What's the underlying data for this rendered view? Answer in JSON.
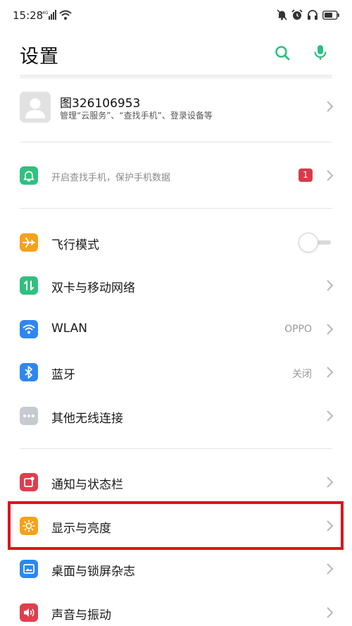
{
  "status_bar": {
    "time": "15:28",
    "left_icons": [
      "4g-signal-icon",
      "wifi-icon"
    ],
    "right_icons": [
      "mute-icon",
      "alarm-icon",
      "headphones-icon",
      "battery-icon"
    ]
  },
  "header": {
    "title": "设置",
    "actions": [
      "search-icon",
      "microphone-icon"
    ],
    "accent_color": "#2dbf7f"
  },
  "account": {
    "name": "图326106953",
    "subtitle": "管理“云服务”、“查找手机”、登录设备等"
  },
  "find_phone": {
    "text": "开启查找手机，保护手机数据",
    "badge": "1",
    "icon": "bell-icon",
    "icon_color": "#30c17f"
  },
  "network_items": [
    {
      "label": "飞行模式",
      "icon": "airplane-icon",
      "icon_color": "#f6a21a",
      "control": "toggle",
      "enabled": false
    },
    {
      "label": "双卡与移动网络",
      "icon": "sim-data-icon",
      "icon_color": "#30c17f"
    },
    {
      "label": "WLAN",
      "icon": "wifi-icon",
      "icon_color": "#2f86f0",
      "value": "OPPO"
    },
    {
      "label": "蓝牙",
      "icon": "bluetooth-icon",
      "icon_color": "#2f86f0",
      "value": "关闭"
    },
    {
      "label": "其他无线连接",
      "icon": "more-dots-icon",
      "icon_color": "#c7cad1"
    }
  ],
  "display_items": [
    {
      "label": "通知与状态栏",
      "icon": "notification-icon",
      "icon_color": "#e03e4e"
    },
    {
      "label": "显示与亮度",
      "icon": "brightness-icon",
      "icon_color": "#f6a21a",
      "highlighted": true
    },
    {
      "label": "桌面与锁屏杂志",
      "icon": "wallpaper-icon",
      "icon_color": "#2f86f0"
    },
    {
      "label": "声音与振动",
      "icon": "speaker-icon",
      "icon_color": "#e03e4e"
    }
  ],
  "highlight_color": "#e0131b"
}
